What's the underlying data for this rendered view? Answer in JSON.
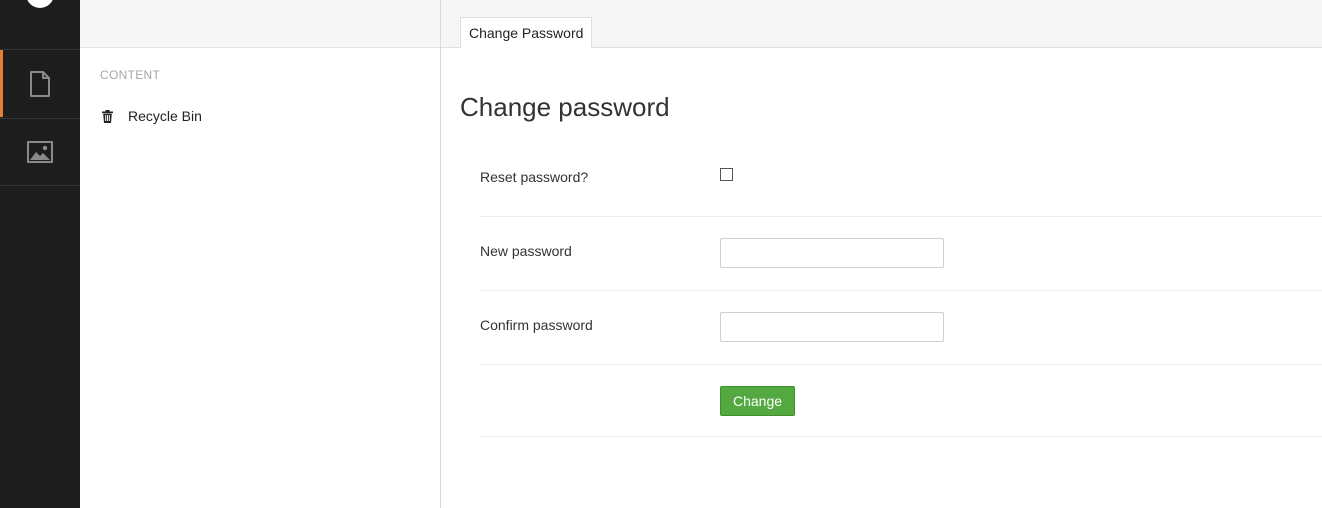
{
  "rail": {
    "sections": [
      {
        "icon": "document-icon",
        "active": true
      },
      {
        "icon": "image-icon",
        "active": false
      }
    ],
    "accent_color": "#e47f35"
  },
  "tree": {
    "heading": "CONTENT",
    "items": [
      {
        "label": "Recycle Bin",
        "icon": "trash-icon"
      }
    ]
  },
  "tabs": [
    {
      "label": "Change Password"
    }
  ],
  "form": {
    "title": "Change password",
    "reset_label": "Reset password?",
    "reset_checked": false,
    "new_password_label": "New password",
    "new_password_value": "",
    "confirm_password_label": "Confirm password",
    "confirm_password_value": "",
    "submit_label": "Change",
    "submit_color": "#53a93f"
  }
}
